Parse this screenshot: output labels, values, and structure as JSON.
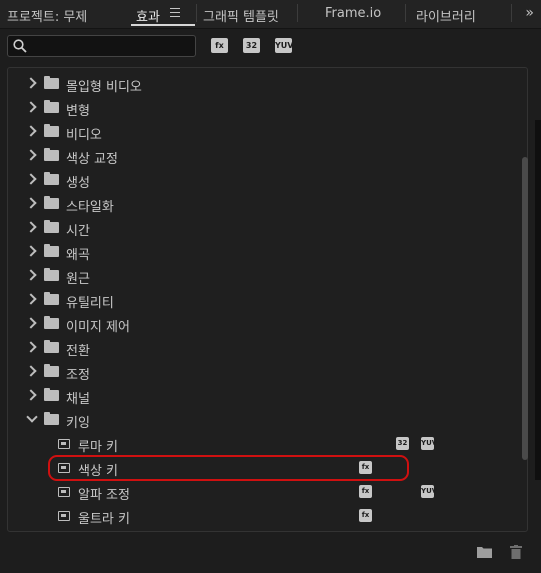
{
  "tabs": {
    "project": "프로젝트: 무제",
    "effects": "효과",
    "graphics_templates": "그래픽 템플릿",
    "frameio": "Frame.io",
    "library": "라이브러리",
    "overflow": "»"
  },
  "search": {
    "placeholder": ""
  },
  "filters": {
    "accelerated": "fx",
    "bit32": "32",
    "yuv": "YUV"
  },
  "tree": {
    "folders": [
      {
        "label": "몰입형 비디오"
      },
      {
        "label": "변형"
      },
      {
        "label": "비디오"
      },
      {
        "label": "색상 교정"
      },
      {
        "label": "생성"
      },
      {
        "label": "스타일화"
      },
      {
        "label": "시간"
      },
      {
        "label": "왜곡"
      },
      {
        "label": "원근"
      },
      {
        "label": "유틸리티"
      },
      {
        "label": "이미지 제어"
      },
      {
        "label": "전환"
      },
      {
        "label": "조정"
      },
      {
        "label": "채널"
      },
      {
        "label": "키잉"
      }
    ],
    "keying_items": [
      {
        "label": "루마 키",
        "badges": [
          "32",
          "YUV"
        ]
      },
      {
        "label": "색상 키",
        "badges": [
          "fx"
        ]
      },
      {
        "label": "알파 조정",
        "badges": [
          "fx",
          "YUV"
        ]
      },
      {
        "label": "울트라 키",
        "badges": [
          "fx"
        ]
      }
    ]
  },
  "colors": {
    "highlight": "#d01010",
    "panel": "#1f1f1f"
  },
  "icons": {
    "new_folder": "folder-icon",
    "delete": "trash-icon"
  }
}
